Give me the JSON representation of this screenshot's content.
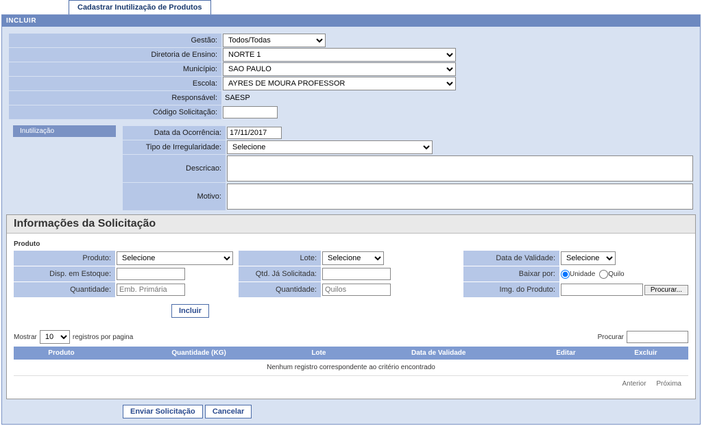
{
  "tab_title": "Cadastrar Inutilização de Produtos",
  "panel_title": "INCLUIR",
  "form": {
    "gestao_label": "Gestão:",
    "gestao_value": "Todos/Todas",
    "diretoria_label": "Diretoria de Ensino:",
    "diretoria_value": "NORTE 1",
    "municipio_label": "Município:",
    "municipio_value": "SAO PAULO",
    "escola_label": "Escola:",
    "escola_value": "AYRES DE MOURA PROFESSOR",
    "responsavel_label": "Responsável:",
    "responsavel_value": "SAESP",
    "codigo_label": "Código Solicitação:",
    "codigo_value": ""
  },
  "subtab": "Inutilização",
  "subform": {
    "data_label": "Data da Ocorrência:",
    "data_value": "17/11/2017",
    "tipo_label": "Tipo de Irregularidade:",
    "tipo_value": "Selecione",
    "descricao_label": "Descricao:",
    "descricao_value": "",
    "motivo_label": "Motivo:",
    "motivo_value": ""
  },
  "info": {
    "title": "Informações da Solicitação",
    "fieldset": "Produto",
    "produto_label": "Produto:",
    "produto_value": "Selecione",
    "lote_label": "Lote:",
    "lote_value": "Selecione",
    "validade_label": "Data de Validade:",
    "validade_value": "Selecione",
    "disp_label": "Disp. em Estoque:",
    "disp_value": "",
    "qtd_sol_label": "Qtd. Já Solicitada:",
    "qtd_sol_value": "",
    "baixar_label": "Baixar por:",
    "baixar_unidade": "Unidade",
    "baixar_quilo": "Quilo",
    "quantidade1_label": "Quantidade:",
    "quantidade1_value": "Emb. Primária",
    "quantidade2_label": "Quantidade:",
    "quantidade2_value": "Quilos",
    "img_label": "Img. do Produto:",
    "procurar": "Procurar...",
    "incluir_btn": "Incluir"
  },
  "pager": {
    "mostrar": "Mostrar",
    "registros": "registros por pagina",
    "per_page": "10",
    "procurar_label": "Procurar"
  },
  "grid": {
    "col_produto": "Produto",
    "col_qtd": "Quantidade (KG)",
    "col_lote": "Lote",
    "col_validade": "Data de Validade",
    "col_editar": "Editar",
    "col_excluir": "Excluir",
    "empty": "Nenhum registro correspondente ao critério encontrado"
  },
  "nav": {
    "anterior": "Anterior",
    "proxima": "Próxima"
  },
  "actions": {
    "enviar": "Enviar Solicitação",
    "cancelar": "Cancelar"
  }
}
